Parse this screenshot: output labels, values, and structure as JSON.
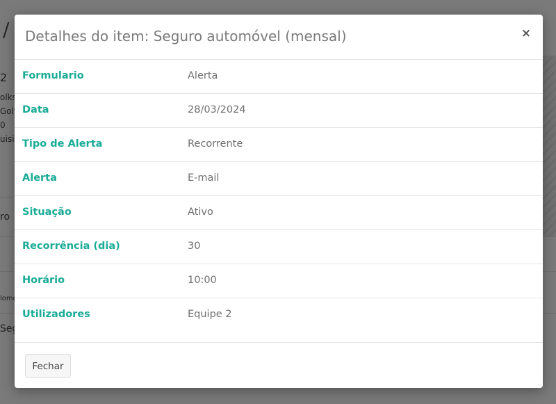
{
  "background": {
    "fragments": [
      "/",
      "2",
      "olks",
      "Golf",
      "0",
      "uisiç",
      "ro",
      "lome",
      "Seg"
    ]
  },
  "modal": {
    "title": "Detalhes do item: Seguro automóvel (mensal)",
    "close_icon": "×",
    "rows": [
      {
        "label": "Formulario",
        "value": "Alerta"
      },
      {
        "label": "Data",
        "value": "28/03/2024"
      },
      {
        "label": "Tipo de Alerta",
        "value": "Recorrente"
      },
      {
        "label": "Alerta",
        "value": "E-mail"
      },
      {
        "label": "Situação",
        "value": "Ativo"
      },
      {
        "label": "Recorrência (dia)",
        "value": "30"
      },
      {
        "label": "Horário",
        "value": "10:00"
      },
      {
        "label": "Utilizadores",
        "value": "Equipe 2"
      }
    ],
    "footer": {
      "close_label": "Fechar"
    }
  },
  "colors": {
    "label_accent": "#1aab97",
    "overlay": "rgba(0,0,0,0.5)"
  }
}
